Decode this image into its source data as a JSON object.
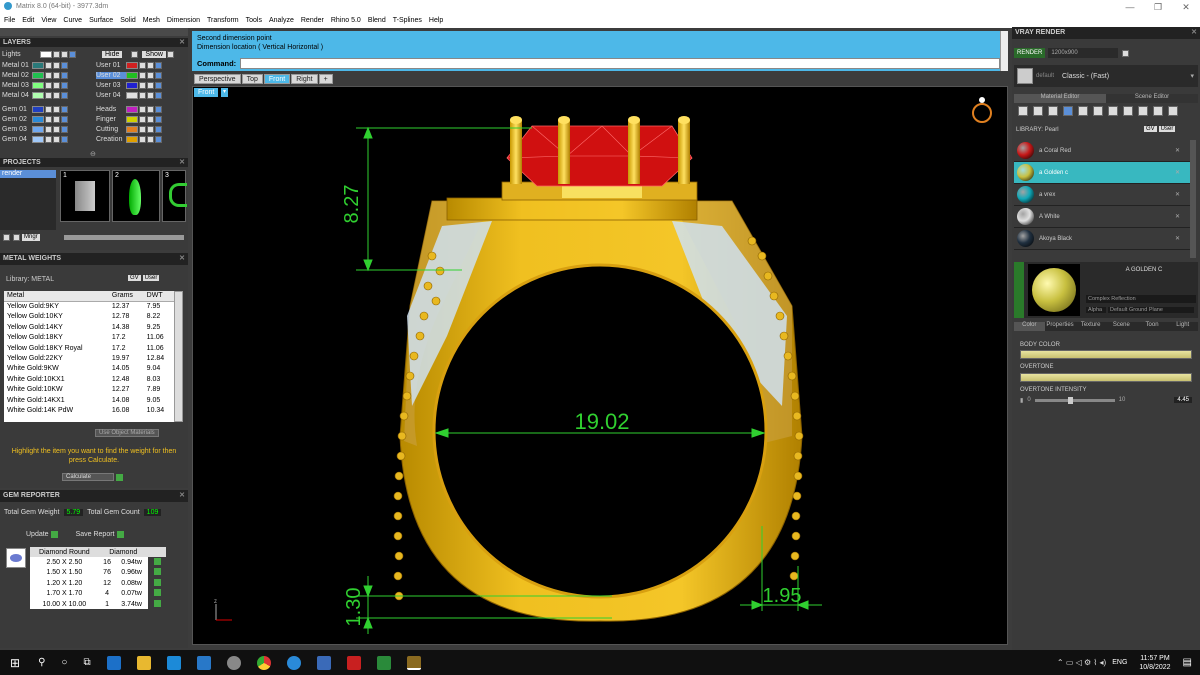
{
  "window": {
    "title": "Matrix 8.0 (64-bit) - 3977.3dm",
    "minimize": "—",
    "maximize": "❐",
    "close": "✕"
  },
  "menu": [
    "File",
    "Edit",
    "View",
    "Curve",
    "Surface",
    "Solid",
    "Mesh",
    "Dimension",
    "Transform",
    "Tools",
    "Analyze",
    "Render",
    "Rhino 5.0",
    "Blend",
    "T-Splines",
    "Help"
  ],
  "layers": {
    "title": "LAYERS",
    "lights": "Lights",
    "hide": "Hide",
    "show": "Show",
    "left": [
      {
        "name": "Metal 01",
        "color": "#2a7a7a"
      },
      {
        "name": "Metal 02",
        "color": "#20c050"
      },
      {
        "name": "Metal 03",
        "color": "#80ff80"
      },
      {
        "name": "Metal 04",
        "color": "#b0ffb0"
      },
      {
        "name": "Gem 01",
        "color": "#2040c0"
      },
      {
        "name": "Gem 02",
        "color": "#2a8ad8"
      },
      {
        "name": "Gem 03",
        "color": "#70a8f0"
      },
      {
        "name": "Gem 04",
        "color": "#a0c8f8"
      }
    ],
    "right": [
      {
        "name": "User 01",
        "color": "#d02020"
      },
      {
        "name": "User 02",
        "color": "#20c020"
      },
      {
        "name": "User 03",
        "color": "#2020d0"
      },
      {
        "name": "User 04",
        "color": "#e0e0e0"
      },
      {
        "name": "Heads",
        "color": "#c020c0"
      },
      {
        "name": "Finger",
        "color": "#d0d000"
      },
      {
        "name": "Cutting",
        "color": "#e08020"
      },
      {
        "name": "Creation",
        "color": "#e0a000"
      }
    ]
  },
  "projects": {
    "title": "PROJECTS",
    "item": "render",
    "thumbs": [
      "1",
      "2",
      "3"
    ],
    "mngr": "Mngr"
  },
  "metal_weights": {
    "title": "METAL WEIGHTS",
    "library": "Library: METAL",
    "gv": "GV",
    "user": "User",
    "headers": [
      "Metal",
      "Grams",
      "DWT"
    ],
    "rows": [
      [
        "Yellow Gold:9KY",
        "12.37",
        "7.95"
      ],
      [
        "Yellow Gold:10KY",
        "12.78",
        "8.22"
      ],
      [
        "Yellow Gold:14KY",
        "14.38",
        "9.25"
      ],
      [
        "Yellow Gold:18KY",
        "17.2",
        "11.06"
      ],
      [
        "Yellow Gold:18KY Royal",
        "17.2",
        "11.06"
      ],
      [
        "Yellow Gold:22KY",
        "19.97",
        "12.84"
      ],
      [
        "White Gold:9KW",
        "14.05",
        "9.04"
      ],
      [
        "White Gold:10KX1",
        "12.48",
        "8.03"
      ],
      [
        "White Gold:10KW",
        "12.27",
        "7.89"
      ],
      [
        "White Gold:14KX1",
        "14.08",
        "9.05"
      ],
      [
        "White Gold:14K PdW",
        "16.08",
        "10.34"
      ]
    ],
    "use_object": "Use Object Materials",
    "hint": "Highlight the item you want to find the weight for then press Calculate.",
    "calculate": "Calculate"
  },
  "gem_reporter": {
    "title": "GEM REPORTER",
    "total_weight_label": "Total Gem Weight",
    "total_weight": "5.79",
    "total_count_label": "Total Gem Count",
    "total_count": "109",
    "update": "Update",
    "save_report": "Save Report",
    "headers": [
      "Diamond Round",
      "Diamond"
    ],
    "rows": [
      [
        "2.50 X 2.50",
        "16",
        "0.94tw"
      ],
      [
        "1.50 X 1.50",
        "76",
        "0.96tw"
      ],
      [
        "1.20 X 1.20",
        "12",
        "0.08tw"
      ],
      [
        "1.70 X 1.70",
        "4",
        "0.07tw"
      ],
      [
        "10.00 X 10.00",
        "1",
        "3.74tw"
      ]
    ]
  },
  "command": {
    "line1": "Second dimension point",
    "line2": "Dimension location ( Vertical  Horizontal )",
    "prompt": "Command:"
  },
  "viewport_tabs": [
    "Perspective",
    "Top",
    "Front",
    "Right"
  ],
  "viewport_label": "Front",
  "dims": {
    "height": "8.27",
    "width": "19.02",
    "bottom": "1.30",
    "side": "1.95"
  },
  "vray": {
    "title": "VRAY RENDER",
    "render": "RENDER",
    "resolution": "1200x900",
    "preset_small": "default",
    "preset": "Classic - (Fast)",
    "tabs": [
      "Material Editor",
      "Scene Editor"
    ],
    "library": "LIBRARY: Pearl",
    "gv": "GV",
    "user": "User",
    "materials": [
      {
        "name": "a Coral Red",
        "color": "#c81818"
      },
      {
        "name": "a Golden c",
        "color": "#c8c040"
      },
      {
        "name": "a vrex",
        "color": "#10a8b8"
      },
      {
        "name": "A White",
        "color": "#e0e0e0"
      },
      {
        "name": "Akoya Black",
        "color": "#203040"
      }
    ],
    "selected_name": "A GOLDEN C",
    "reflection": "Complex Reflection",
    "alpha": "Alpha",
    "ground": "Default Ground Plane",
    "prop_tabs": [
      "Color",
      "Properties",
      "Texture",
      "Scene",
      "Toon",
      "Light"
    ],
    "body_color": "BODY COLOR",
    "overtone": "OVERTONE",
    "overtone_intensity": "OVERTONE INTENSITY",
    "oi_min": "0",
    "oi_max": "10",
    "oi_value": "4.45"
  },
  "taskbar": {
    "lang": "ENG",
    "time": "11:57 PM",
    "date": "10/8/2022"
  }
}
